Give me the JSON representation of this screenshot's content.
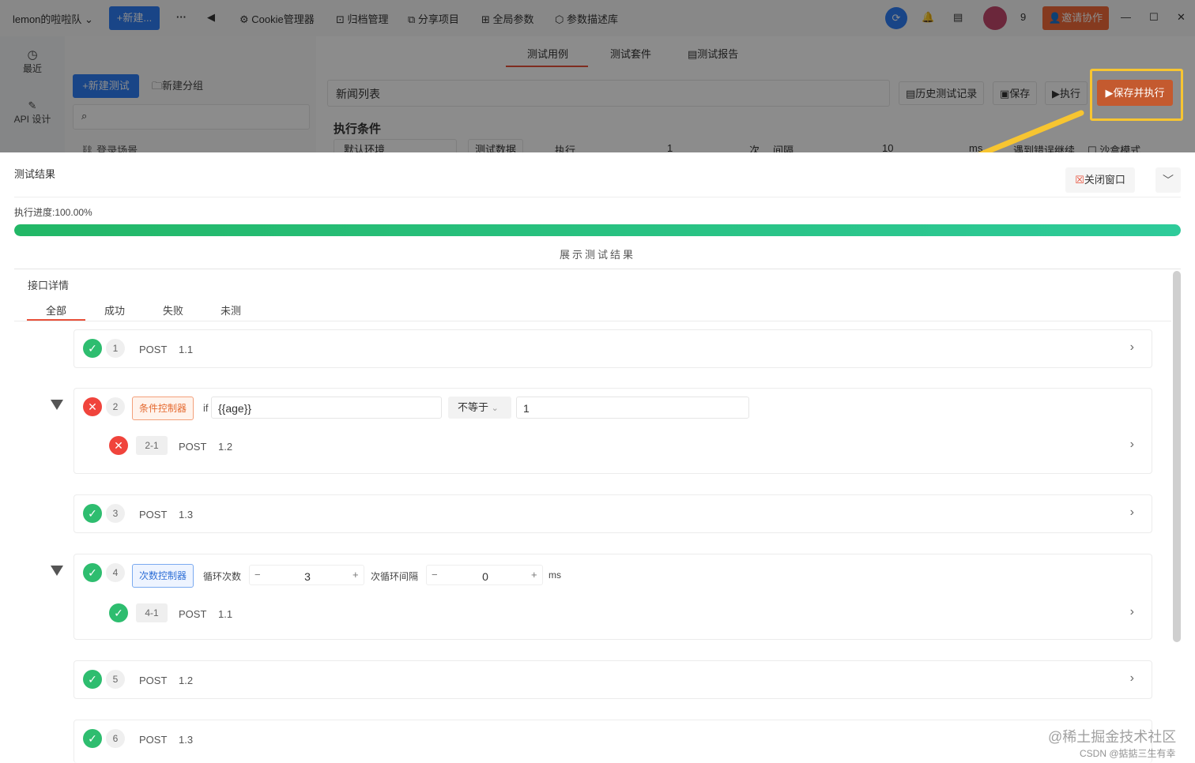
{
  "titlebar": {
    "team": "lemon的啦啦队",
    "new_btn": "+新建...",
    "more": "···",
    "menus": [
      "Cookie管理器",
      "归档管理",
      "分享项目",
      "全局参数",
      "参数描述库"
    ],
    "notif_count": "9",
    "invite_btn": "邀请协作"
  },
  "sidebar": {
    "items": [
      "最近",
      "API 设计"
    ]
  },
  "leftpane": {
    "new_test_btn": "+新建测试",
    "new_group_btn": "新建分组",
    "tree_item": "登录场景"
  },
  "main": {
    "tabs": [
      "测试用例",
      "测试套件",
      "测试报告"
    ],
    "case_name": "新闻列表",
    "history_btn": "历史测试记录",
    "save_btn": "保存",
    "run_btn": "执行",
    "save_run_btn": "保存并执行",
    "conditions_label": "执行条件",
    "env": "默认环境",
    "test_data": "测试数据",
    "exec_label": "执行",
    "exec_times": "1",
    "times_unit": "次",
    "interval_label": "间隔",
    "interval_val": "10",
    "ms_unit": "ms",
    "continue_label": "遇到错误继续",
    "sandbox_label": "沙盒模式"
  },
  "drawer": {
    "title": "测试结果",
    "close_btn": "关闭窗口",
    "progress_label": "执行进度:100.00%",
    "progress": 1.0,
    "show_results": "展示测试结果",
    "details_label": "接口详情",
    "filter_tabs": [
      "全部",
      "成功",
      "失败",
      "未测"
    ],
    "rows": [
      {
        "idx": "1",
        "method": "POST",
        "name": "1.1"
      },
      {
        "idx": "2",
        "ctrl": "条件控制器",
        "if": "if",
        "var": "{{age}}",
        "op": "不等于",
        "val": "1",
        "child": {
          "idx": "2-1",
          "method": "POST",
          "name": "1.2"
        }
      },
      {
        "idx": "3",
        "method": "POST",
        "name": "1.3"
      },
      {
        "idx": "4",
        "ctrl": "次数控制器",
        "loop_label": "循环次数",
        "loop_val": "3",
        "interval_label": "次循环间隔",
        "interval_val": "0",
        "unit": "ms",
        "child": {
          "idx": "4-1",
          "method": "POST",
          "name": "1.1"
        }
      },
      {
        "idx": "5",
        "method": "POST",
        "name": "1.2"
      },
      {
        "idx": "6",
        "method": "POST",
        "name": "1.3"
      }
    ]
  },
  "watermark": {
    "line1": "@稀土掘金技术社区",
    "line2": "CSDN @掂掂三生有幸"
  },
  "colors": {
    "accent": "#2f7ef6",
    "success": "#2ebd6f",
    "error": "#f0443c",
    "highlight": "#f7c531",
    "orange": "#f26b3a"
  }
}
